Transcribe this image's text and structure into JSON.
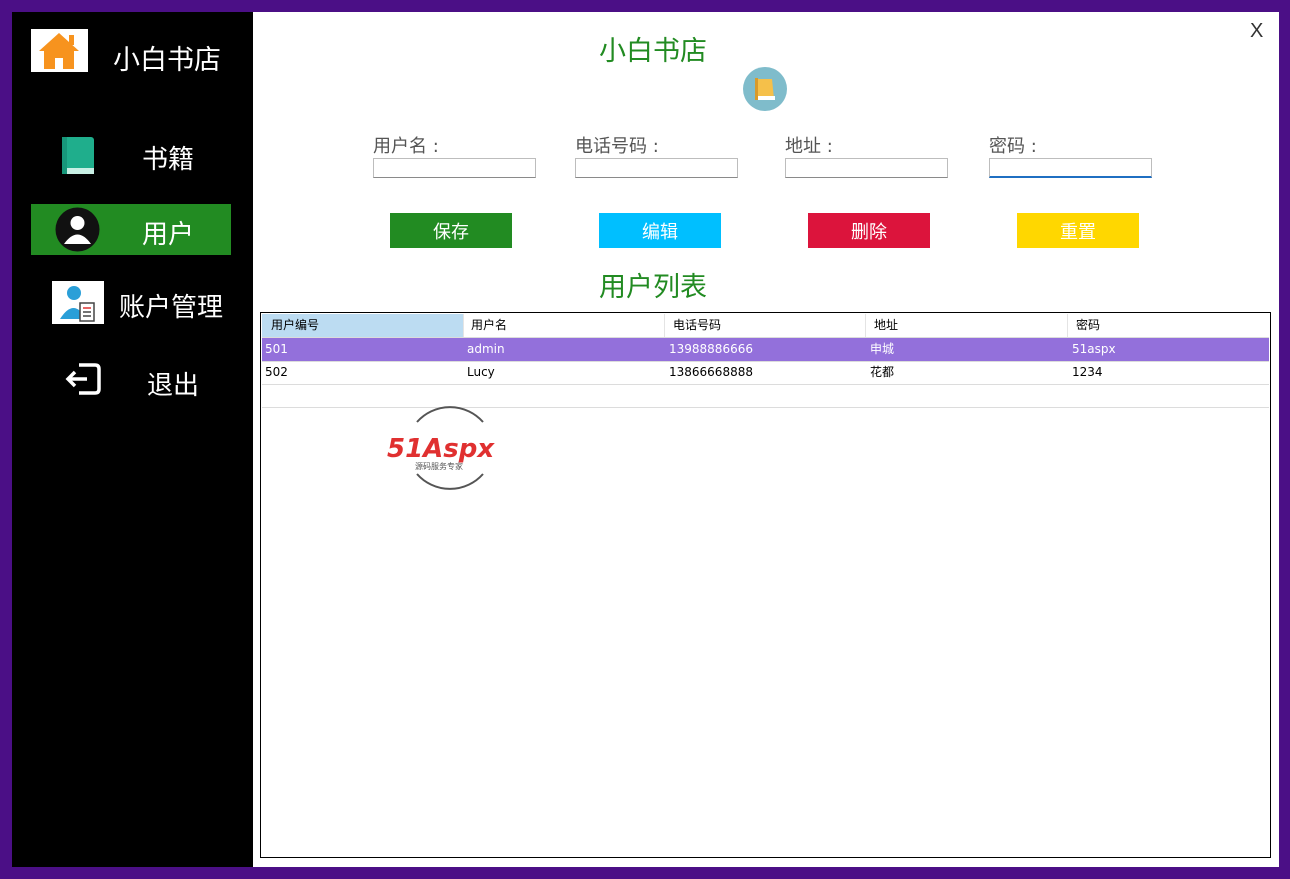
{
  "sidebar": {
    "brand_name": "小白书店",
    "items": [
      {
        "label": "书籍",
        "icon": "book-icon"
      },
      {
        "label": "用户",
        "icon": "user-avatar-icon"
      },
      {
        "label": "账户管理",
        "icon": "account-manage-icon"
      },
      {
        "label": "退出",
        "icon": "logout-icon"
      }
    ],
    "active_item": "用户"
  },
  "header": {
    "close_label": "X",
    "title": "小白书店",
    "title_icon": "book-circle-icon"
  },
  "form": {
    "username_label": "用户名 :",
    "phone_label": "电话号码 :",
    "address_label": "地址 :",
    "password_label": "密码 :",
    "username_value": "",
    "phone_value": "",
    "address_value": "",
    "password_value": ""
  },
  "buttons": {
    "save": "保存",
    "edit": "编辑",
    "delete": "删除",
    "reset": "重置"
  },
  "list": {
    "title": "用户列表",
    "columns": [
      "用户编号",
      "用户名",
      "电话号码",
      "地址",
      "密码"
    ],
    "rows": [
      [
        "501",
        "admin",
        "13988886666",
        "申城",
        "51aspx"
      ],
      [
        "502",
        "Lucy",
        "13866668888",
        "花都",
        "1234"
      ]
    ]
  },
  "watermark": {
    "brand": "51Aspx",
    "tagline": "源码服务专家"
  },
  "colors": {
    "window_border": "#4b0f86",
    "accent_green": "#228b22",
    "edit_blue": "#00bfff",
    "delete_red": "#dc143c",
    "reset_yellow": "#ffd700",
    "selected_row": "#9370db"
  }
}
